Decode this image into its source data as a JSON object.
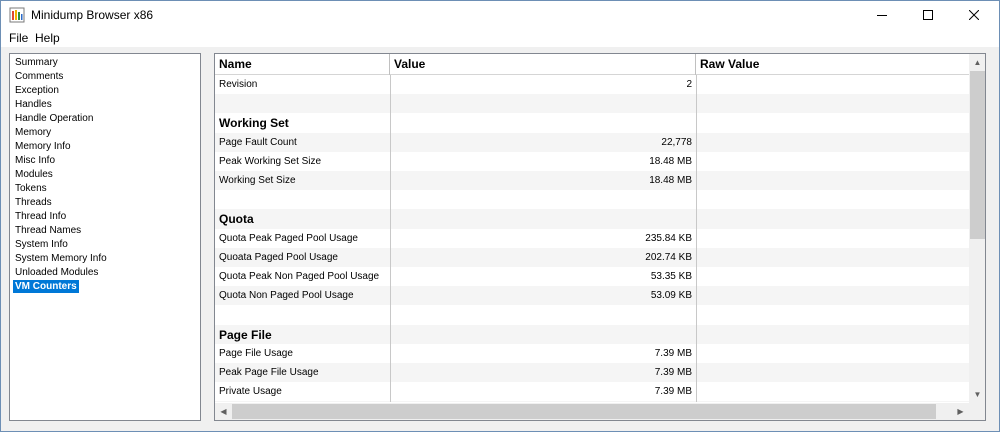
{
  "window": {
    "title": "Minidump Browser x86",
    "icon": "minidump-app-icon"
  },
  "menu": [
    "File",
    "Help"
  ],
  "tree": {
    "items": [
      "Summary",
      "Comments",
      "Exception",
      "Handles",
      "Handle Operation",
      "Memory",
      "Memory Info",
      "Misc Info",
      "Modules",
      "Tokens",
      "Threads",
      "Thread Info",
      "Thread Names",
      "System Info",
      "System Memory Info",
      "Unloaded Modules",
      "VM Counters"
    ],
    "selected": "VM Counters"
  },
  "grid": {
    "columns": [
      "Name",
      "Value",
      "Raw Value"
    ],
    "rows": [
      {
        "type": "row",
        "name": "Revision",
        "value": "2",
        "raw": ""
      },
      {
        "type": "blank",
        "name": "",
        "value": "",
        "raw": ""
      },
      {
        "type": "section",
        "name": "Working Set",
        "value": "",
        "raw": ""
      },
      {
        "type": "row",
        "name": "Page Fault Count",
        "value": "22,778",
        "raw": ""
      },
      {
        "type": "row",
        "name": "Peak Working Set Size",
        "value": "18.48 MB",
        "raw": ""
      },
      {
        "type": "row",
        "name": "Working Set Size",
        "value": "18.48 MB",
        "raw": ""
      },
      {
        "type": "blank",
        "name": "",
        "value": "",
        "raw": ""
      },
      {
        "type": "section",
        "name": "Quota",
        "value": "",
        "raw": ""
      },
      {
        "type": "row",
        "name": "Quota Peak Paged Pool Usage",
        "value": "235.84 KB",
        "raw": ""
      },
      {
        "type": "row",
        "name": "Quoata Paged Pool Usage",
        "value": "202.74 KB",
        "raw": ""
      },
      {
        "type": "row",
        "name": "Quota Peak Non Paged Pool Usage",
        "value": "53.35 KB",
        "raw": ""
      },
      {
        "type": "row",
        "name": "Quota Non Paged Pool Usage",
        "value": "53.09 KB",
        "raw": ""
      },
      {
        "type": "blank",
        "name": "",
        "value": "",
        "raw": ""
      },
      {
        "type": "section",
        "name": "Page File",
        "value": "",
        "raw": ""
      },
      {
        "type": "row",
        "name": "Page File Usage",
        "value": "7.39 MB",
        "raw": ""
      },
      {
        "type": "row",
        "name": "Peak Page File Usage",
        "value": "7.39 MB",
        "raw": ""
      },
      {
        "type": "row",
        "name": "Private Usage",
        "value": "7.39 MB",
        "raw": ""
      },
      {
        "type": "blank",
        "name": "",
        "value": "",
        "raw": ""
      }
    ]
  },
  "colors": {
    "selection": "#0078d7",
    "window_border": "#6d8fb5",
    "alt_row": "#f5f5f5"
  }
}
